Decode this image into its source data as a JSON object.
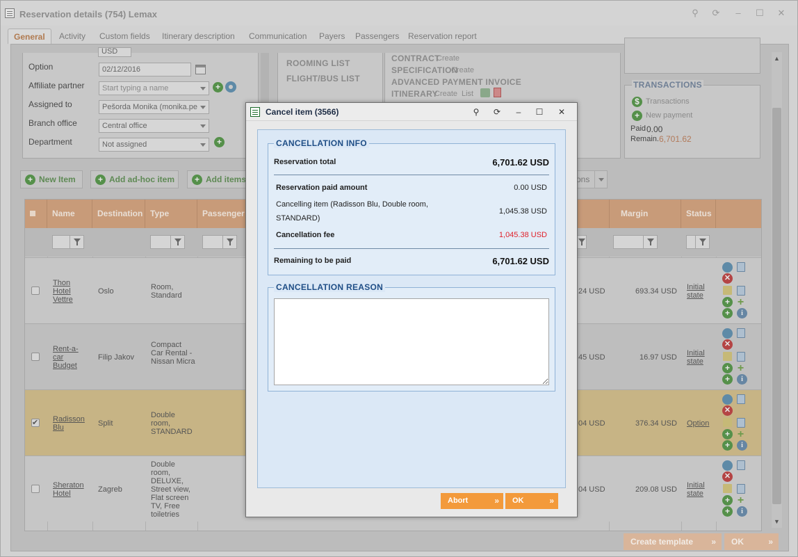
{
  "window": {
    "title": "Reservation details (754) Lemax"
  },
  "tabs": [
    "General",
    "Activity",
    "Custom fields",
    "Itinerary description",
    "Communication",
    "Payers",
    "Passengers",
    "Reservation report"
  ],
  "form": {
    "top_value": "USD",
    "option_label": "Option",
    "option_value": "02/12/2016",
    "affiliate_label": "Affiliate partner",
    "affiliate_placeholder": "Start typing a name",
    "assigned_label": "Assigned to",
    "assigned_value": "Pešorda Monika (monika.pe",
    "branch_label": "Branch office",
    "branch_value": "Central office",
    "department_label": "Department",
    "department_value": "Not assigned"
  },
  "lists": {
    "rooming": "ROOMING LIST",
    "flight": "FLIGHT/BUS LIST"
  },
  "docs": {
    "contract": "CONTRACT",
    "contract_create": "Create",
    "specification": "SPECIFICATION",
    "specification_create": "Create",
    "advanced": "ADVANCED PAYMENT INVOICE",
    "itinerary": "ITINERARY",
    "itinerary_create": "Create",
    "itinerary_list": "List"
  },
  "transactions": {
    "title": "TRANSACTIONS",
    "link": "Transactions",
    "new_payment": "New payment",
    "paid_label": "Paid",
    "paid_value": "0.00",
    "remain_label": "Remain.",
    "remain_value": "6,701.62"
  },
  "toolbar": {
    "new_item": "New Item",
    "add_adhoc": "Add ad-hoc item",
    "add_items": "Add items",
    "options_tail": "ons"
  },
  "grid": {
    "headers": {
      "name": "Name",
      "destination": "Destination",
      "type": "Type",
      "passenger": "Passenger",
      "margin": "Margin",
      "status": "Status"
    },
    "rows": [
      {
        "name": "Thon Hotel Vettre",
        "destination": "Oslo",
        "type": "Room, Standard",
        "amount": "24 USD",
        "margin": "693.34 USD",
        "status": "Initial state",
        "checked": false
      },
      {
        "name": "Rent-a-car Budget",
        "destination": "Filip Jakov",
        "type": "Compact Car Rental - Nissan Micra",
        "amount": "45 USD",
        "margin": "16.97 USD",
        "status": "Initial state",
        "checked": false
      },
      {
        "name": "Radisson Blu",
        "destination": "Split",
        "type": "Double room, STANDARD",
        "amount": "04 USD",
        "margin": "376.34 USD",
        "status": "Option",
        "checked": true
      },
      {
        "name": "Sheraton Hotel",
        "destination": "Zagreb",
        "type": "Double room, DELUXE, Street view, Flat screen TV, Free toiletries",
        "amount": "04 USD",
        "margin": "209.08 USD",
        "status": "Initial state",
        "checked": false
      }
    ]
  },
  "footer": {
    "create_template": "Create template",
    "ok": "OK"
  },
  "dialog": {
    "title": "Cancel item (3566)",
    "info_legend": "CANCELLATION INFO",
    "reservation_total_label": "Reservation total",
    "reservation_total_value": "6,701.62 USD",
    "paid_amount_label": "Reservation paid amount",
    "paid_amount_value": "0.00 USD",
    "cancelling_item_label": "Cancelling item (Radisson Blu, Double room, STANDARD)",
    "cancelling_item_value": "1,045.38 USD",
    "fee_label": "Cancellation fee",
    "fee_value": "1,045.38 USD",
    "remaining_label": "Remaining to be paid",
    "remaining_value": "6,701.62 USD",
    "reason_legend": "CANCELLATION REASON",
    "reason_value": "",
    "abort": "Abort",
    "ok": "OK"
  },
  "colors": {
    "accent_orange": "#f39a3b",
    "dialog_blue": "#1f4e86",
    "fee_red": "#e0202a"
  }
}
